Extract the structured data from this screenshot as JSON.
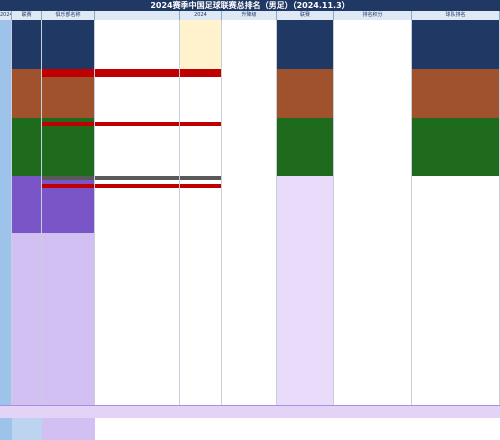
{
  "sheet": {
    "title": "2024赛季中国足球联赛总排名（男足）（2024.11.3）",
    "footer_note": "",
    "columns": [
      "2024",
      "联赛",
      "俱乐部名称",
      "2024",
      "升降级",
      "联赛",
      "排名积分",
      "球队排名"
    ]
  },
  "segment_colors": {
    "sky": "#9ec3ea",
    "navy": "#1f3864",
    "brown": "#a0522d",
    "green": "#1e6b1e",
    "purple": "#7a55c8",
    "lilac": "#d3c0f2",
    "white": "#ffffff",
    "cream": "#fff2cc",
    "red": "#c00000",
    "gray": "#595959",
    "lavender": "#e9dcfb"
  }
}
